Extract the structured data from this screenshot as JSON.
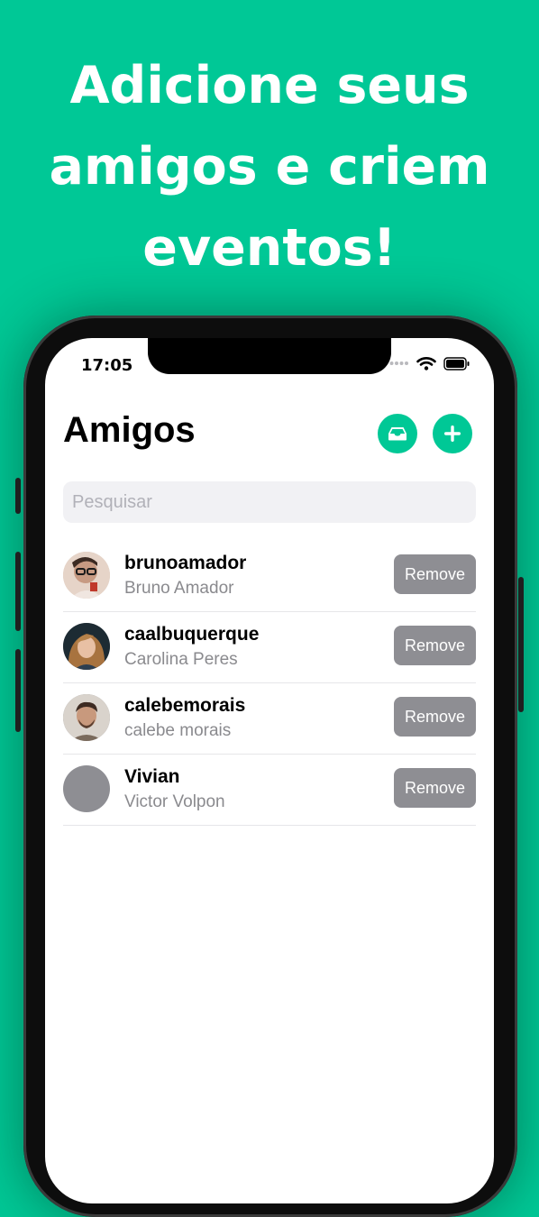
{
  "promo": {
    "headline_lines": [
      "Adicione seus",
      "amigos e criem",
      "eventos!"
    ]
  },
  "status_bar": {
    "time": "17:05"
  },
  "header": {
    "title": "Amigos",
    "inbox_icon": "tray-icon",
    "add_icon": "plus-icon"
  },
  "search": {
    "placeholder": "Pesquisar",
    "value": ""
  },
  "friends": [
    {
      "username": "brunoamador",
      "full_name": "Bruno Amador",
      "action": "Remove",
      "has_photo": true
    },
    {
      "username": "caalbuquerque",
      "full_name": "Carolina Peres",
      "action": "Remove",
      "has_photo": true
    },
    {
      "username": "calebemorais",
      "full_name": "calebe morais",
      "action": "Remove",
      "has_photo": true
    },
    {
      "username": "Vivian",
      "full_name": "Victor Volpon",
      "action": "Remove",
      "has_photo": false
    }
  ],
  "colors": {
    "brand": "#00c896",
    "remove_button": "#8e8e93",
    "secondary_text": "#8a8a8e"
  }
}
